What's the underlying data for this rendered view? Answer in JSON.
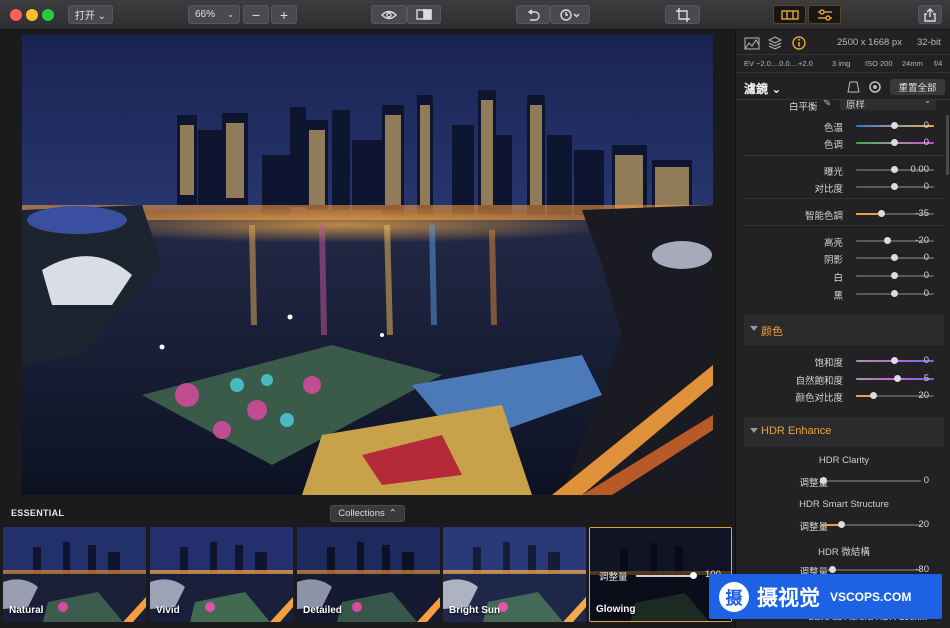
{
  "toolbar": {
    "open_label": "打开 ⌄",
    "zoom_label": "66%",
    "zoom_minus": "−",
    "zoom_plus": "+"
  },
  "photo_alt": "",
  "strip": {
    "section_label": "ESSENTIAL",
    "collections_label": "Collections"
  },
  "presets": [
    {
      "label": "Natural"
    },
    {
      "label": "Vivid"
    },
    {
      "label": "Detailed"
    },
    {
      "label": "Bright Sun"
    },
    {
      "label": "Glowing",
      "active": true,
      "amount_label": "调整量",
      "amount_value": "100"
    }
  ],
  "info": {
    "dims": "2500 x 1668 px",
    "bits": "32-bit",
    "ev": "EV −2.0....0.0....+2.0",
    "imgs": "3 img",
    "iso": "ISO 200",
    "focal": "24mm",
    "aperture": "f/4"
  },
  "filters": {
    "title": "濾鏡 ⌄",
    "reset_label": "重置全部"
  },
  "wb": {
    "label": "白平衡",
    "value": "原样"
  },
  "sliders": [
    {
      "label": "色温",
      "value": "0",
      "pos": 0.5,
      "track": "temp"
    },
    {
      "label": "色调",
      "value": "0",
      "pos": 0.5,
      "track": "tint"
    },
    {
      "label": "曝光",
      "value": "0.00",
      "pos": 0.5
    },
    {
      "label": "对比度",
      "value": "0",
      "pos": 0.5
    },
    {
      "label": "智能色調",
      "value": "-35",
      "pos": 0.32,
      "fill": true
    },
    {
      "label": "高亮",
      "value": "-20",
      "pos": 0.4
    },
    {
      "label": "阴影",
      "value": "0",
      "pos": 0.5
    },
    {
      "label": "白",
      "value": "0",
      "pos": 0.5
    },
    {
      "label": "黑",
      "value": "0",
      "pos": 0.5
    },
    {
      "label": "饱和度",
      "value": "0",
      "pos": 0.5,
      "track": "sat"
    },
    {
      "label": "自然飽和度",
      "value": "5",
      "pos": 0.53,
      "track": "sat"
    },
    {
      "label": "颜色对比度",
      "value": "20",
      "pos": 0.2,
      "fill": true
    },
    {
      "label": "调整量",
      "value": "0",
      "pos": 0.0
    },
    {
      "label": "调整量",
      "value": "20",
      "pos": 0.2,
      "fill": true
    },
    {
      "label": "调整量",
      "value": "-80",
      "pos": 0.1
    }
  ],
  "sections": {
    "color": "颜色",
    "hdr": "HDR Enhance"
  },
  "hdr_subs": {
    "clarity": "HDR Clarity",
    "structure": "HDR Smart Structure",
    "fine": "HDR 微結構"
  },
  "bottom_link": "Save as Aurora HDR Look...",
  "watermark": {
    "brand": "摄视觉",
    "site": "VSCOPS.COM"
  },
  "colors": {
    "accent": "#e8a33c",
    "watermark": "#1d62e4"
  }
}
